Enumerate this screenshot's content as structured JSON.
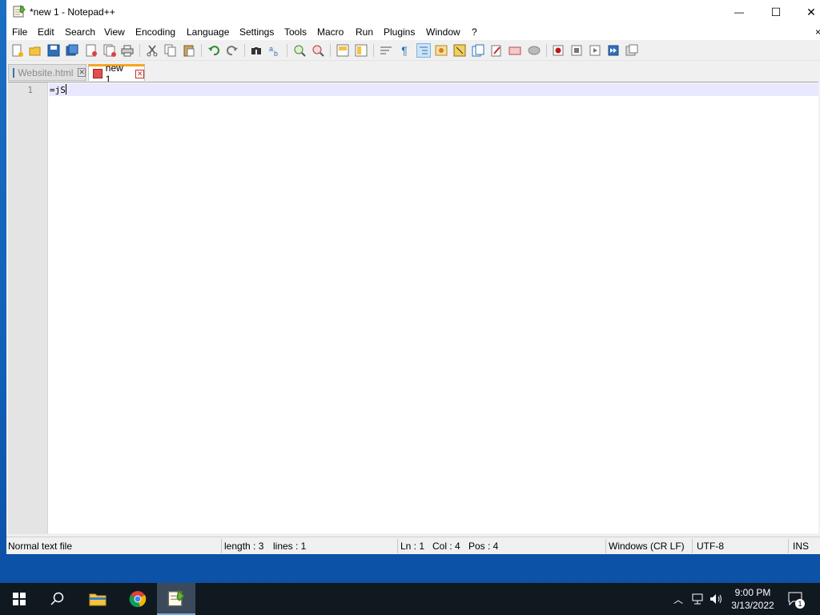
{
  "window": {
    "title": "*new 1 - Notepad++",
    "controls": {
      "minimize": "—",
      "maximize": "☐",
      "close": "✕"
    }
  },
  "menu": [
    "File",
    "Edit",
    "Search",
    "View",
    "Encoding",
    "Language",
    "Settings",
    "Tools",
    "Macro",
    "Run",
    "Plugins",
    "Window",
    "?"
  ],
  "toolbar_icons": [
    "new-file-icon",
    "open-file-icon",
    "save-icon",
    "save-all-icon",
    "close-icon",
    "close-all-icon",
    "print-icon",
    "cut-icon",
    "copy-icon",
    "paste-icon",
    "undo-icon",
    "redo-icon",
    "find-icon",
    "replace-icon",
    "zoom-in-icon",
    "zoom-out-icon",
    "sync-vertical-icon",
    "sync-horizontal-icon",
    "word-wrap-icon",
    "show-all-chars-icon",
    "indent-guide-icon",
    "udl-icon",
    "doc-map-icon",
    "function-list-icon",
    "folder-workspace-icon",
    "monitoring-icon",
    "record-macro-icon",
    "stop-macro-icon",
    "play-macro-icon",
    "run-macro-multiple-icon",
    "save-macro-icon"
  ],
  "tabs": [
    {
      "label": "Website.html",
      "active": false
    },
    {
      "label": "new 1",
      "active": true
    }
  ],
  "editor": {
    "line_number": "1",
    "content": "=jS"
  },
  "status": {
    "file_type": "Normal text file",
    "length": "length : 3",
    "lines": "lines : 1",
    "ln": "Ln : 1",
    "col": "Col : 4",
    "pos": "Pos : 4",
    "eol": "Windows (CR LF)",
    "encoding": "UTF-8",
    "mode": "INS"
  },
  "taskbar": {
    "time": "9:00 PM",
    "date": "3/13/2022",
    "notification_count": "1"
  },
  "colors": {
    "desktop": "#1060b8",
    "taskbar": "#101820",
    "current_line": "#e8e8ff",
    "active_tab_accent": "#f5a623",
    "gutter": "#e4e4e4"
  }
}
